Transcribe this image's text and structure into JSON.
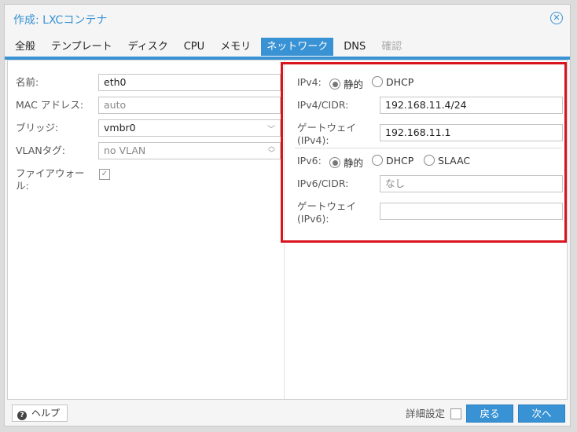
{
  "window": {
    "title": "作成: LXCコンテナ"
  },
  "tabs": [
    {
      "label": "全般",
      "state": "normal"
    },
    {
      "label": "テンプレート",
      "state": "normal"
    },
    {
      "label": "ディスク",
      "state": "normal"
    },
    {
      "label": "CPU",
      "state": "normal"
    },
    {
      "label": "メモリ",
      "state": "normal"
    },
    {
      "label": "ネットワーク",
      "state": "active"
    },
    {
      "label": "DNS",
      "state": "normal"
    },
    {
      "label": "確認",
      "state": "disabled"
    }
  ],
  "left": {
    "name_label": "名前:",
    "name_value": "eth0",
    "mac_label": "MAC アドレス:",
    "mac_placeholder": "auto",
    "bridge_label": "ブリッジ:",
    "bridge_value": "vmbr0",
    "vlan_label": "VLANタグ:",
    "vlan_placeholder": "no VLAN",
    "firewall_label": "ファイアウォール:",
    "firewall_checked": true
  },
  "right": {
    "ipv4_label": "IPv4:",
    "ipv4_static": "静的",
    "ipv4_dhcp": "DHCP",
    "ipv4_selected": "静的",
    "ipv4_cidr_label": "IPv4/CIDR:",
    "ipv4_cidr_value": "192.168.11.4/24",
    "gateway4_label": "ゲートウェイ (IPv4):",
    "gateway4_value": "192.168.11.1",
    "ipv6_label": "IPv6:",
    "ipv6_static": "静的",
    "ipv6_dhcp": "DHCP",
    "ipv6_slaac": "SLAAC",
    "ipv6_selected": "静的",
    "ipv6_cidr_label": "IPv6/CIDR:",
    "ipv6_cidr_placeholder": "なし",
    "gateway6_label": "ゲートウェイ (IPv6):",
    "gateway6_value": ""
  },
  "footer": {
    "help_label": "ヘルプ",
    "advanced_label": "詳細設定",
    "advanced_checked": false,
    "back_label": "戻る",
    "next_label": "次へ"
  },
  "colors": {
    "accent": "#3892d4",
    "highlight": "#d9141e"
  }
}
